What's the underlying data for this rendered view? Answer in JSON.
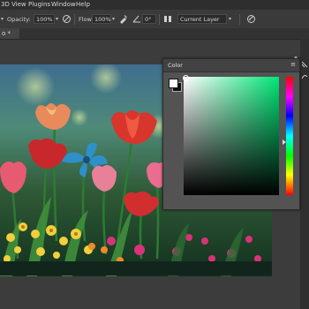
{
  "menubar": {
    "items": [
      "3D",
      "View",
      "Plugins",
      "Window",
      "Help"
    ]
  },
  "optionsbar": {
    "opacity_label": "Opacity:",
    "opacity_value": "100%",
    "flow_label": "Flow:",
    "flow_value": "100%",
    "sample_value": "Current Layer",
    "angle_value": "0°"
  },
  "doc_tab": {
    "label": "o *"
  },
  "color_panel": {
    "title": "Color",
    "menu_glyph": "≡",
    "foreground_color": "#ffffff",
    "background_color": "#111111",
    "field_hue_color": "#00e676"
  },
  "colors": {
    "app_bg": "#3c3c3c",
    "menubar_bg": "#2e2e2e",
    "panel_bg": "#535353"
  }
}
